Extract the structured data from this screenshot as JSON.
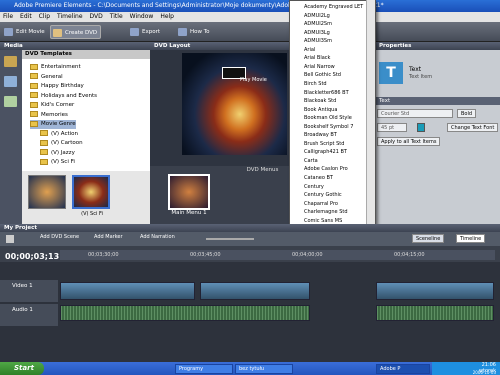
{
  "title_bar": {
    "text": "Adobe Premiere Elements - C:\\Documents and Settings\\Administrator\\Moje dokumenty\\Adobe Premiere Elements\\Projekt1*"
  },
  "menu": [
    "File",
    "Edit",
    "Clip",
    "Timeline",
    "DVD",
    "Title",
    "Window",
    "Help"
  ],
  "toolbar": {
    "edit_movie": "Edit Movie",
    "create_dvd": "Create DVD",
    "export": "Export",
    "how_to": "How To"
  },
  "media_panel": {
    "title": "Media",
    "templates_header": "DVD Templates",
    "tree": [
      {
        "label": "Entertainment",
        "sub": false,
        "sel": false
      },
      {
        "label": "General",
        "sub": false,
        "sel": false
      },
      {
        "label": "Happy Birthday",
        "sub": false,
        "sel": false
      },
      {
        "label": "Holidays and Events",
        "sub": false,
        "sel": false
      },
      {
        "label": "Kid's Corner",
        "sub": false,
        "sel": false
      },
      {
        "label": "Memories",
        "sub": false,
        "sel": false
      },
      {
        "label": "Movie Genre",
        "sub": false,
        "sel": true
      },
      {
        "label": "(V) Action",
        "sub": true,
        "sel": false
      },
      {
        "label": "(V) Cartoon",
        "sub": true,
        "sel": false
      },
      {
        "label": "(V) Jazzy",
        "sub": true,
        "sel": false
      },
      {
        "label": "(V) Sci Fi",
        "sub": true,
        "sel": false
      }
    ],
    "thumb_label": "(V) Sci Fi"
  },
  "dvd_layout": {
    "title": "DVD Layout",
    "play_movie": "Play Movie",
    "menus_label": "DVD Menus",
    "menu_thumb": "Main Menu 1"
  },
  "properties": {
    "title": "Properties",
    "text_label": "Text",
    "text_item": "Text Item",
    "section": "Text",
    "font_value": "Courier Std",
    "bold": "Bold",
    "size": "45 pt",
    "change_font": "Change Text Font",
    "apply_all": "Apply to all Text Items"
  },
  "font_list": [
    "Academy Engraved LET",
    "ADMUI2Lg",
    "ADMUI2Sm",
    "ADMUI3Lg",
    "ADMUI3Sm",
    "Arial",
    "Arial Black",
    "Arial Narrow",
    "Bell Gothic Std",
    "Birch Std",
    "Blackletter686 BT",
    "Blackoak Std",
    "Book Antiqua",
    "Bookman Old Style",
    "Bookshelf Symbol 7",
    "Broadway BT",
    "Brush Script Std",
    "Calligraph421 BT",
    "Carta",
    "Adobe Caslon Pro",
    "Cataneo BT",
    "Century",
    "Century Gothic",
    "Chaparral Pro",
    "Charlemagne Std",
    "Comic Sans MS",
    "Cooper Std",
    "Monotype Corsiva",
    "Courier",
    "Courier New",
    "Courier Std",
    "Eccentric Std",
    "Estrangelo Edessa",
    "Flowdyss",
    "Franklin Gothic Medium",
    "Garamond",
    "Adobe Garamond Pro",
    "Gautami",
    "Georgia",
    "Giddyup Std",
    "Highlight LET",
    "Hobo Std",
    "Holiday/H BT"
  ],
  "font_selected": "Courier Std",
  "project": {
    "title": "My Project",
    "add_dvd_scene": "Add DVD Scene",
    "add_marker": "Add Marker",
    "add_narration": "Add Narration",
    "sceneline": "Sceneline",
    "timeline": "Timeline",
    "timecode": "00;00;03;13",
    "ruler": [
      "00;03;30;00",
      "00;03;45;00",
      "00;04;00;00",
      "00;04;15;00"
    ],
    "video_track": "Video 1",
    "audio_track": "Audio 1"
  },
  "taskbar": {
    "start": "Start",
    "tasks": [
      "Programy",
      "bez tytułu",
      "Adobe P"
    ],
    "time": "21:06",
    "day": "wtorek",
    "date": "2006-10-03"
  }
}
